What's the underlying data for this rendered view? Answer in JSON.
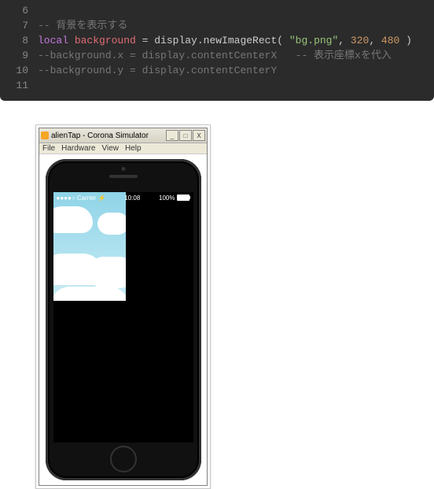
{
  "code": {
    "lines": [
      {
        "n": "6",
        "seg": []
      },
      {
        "n": "7",
        "seg": [
          {
            "c": "comment",
            "t": "-- 背景を表示する"
          }
        ]
      },
      {
        "n": "8",
        "seg": [
          {
            "c": "keyword",
            "t": "local "
          },
          {
            "c": "ident",
            "t": "background"
          },
          {
            "c": "punct",
            "t": " = "
          },
          {
            "c": "func",
            "t": "display.newImageRect( "
          },
          {
            "c": "string",
            "t": "\"bg.png\""
          },
          {
            "c": "punct",
            "t": ", "
          },
          {
            "c": "number",
            "t": "320"
          },
          {
            "c": "punct",
            "t": ", "
          },
          {
            "c": "number",
            "t": "480"
          },
          {
            "c": "punct",
            "t": " )"
          }
        ]
      },
      {
        "n": "9",
        "seg": [
          {
            "c": "comment",
            "t": "--background.x = display.contentCenterX   -- 表示座標xを代入"
          }
        ]
      },
      {
        "n": "10",
        "seg": [
          {
            "c": "comment",
            "t": "--background.y = display.contentCenterY"
          }
        ]
      },
      {
        "n": "11",
        "seg": []
      }
    ]
  },
  "sim": {
    "title": "alienTap - Corona Simulator",
    "menu": [
      "File",
      "Hardware",
      "View",
      "Help"
    ],
    "winbuttons": [
      "_",
      "□",
      "X"
    ],
    "status": {
      "carrier": "●●●●○ Carrier ⚡",
      "time": "10:08",
      "battery": "100%"
    }
  }
}
